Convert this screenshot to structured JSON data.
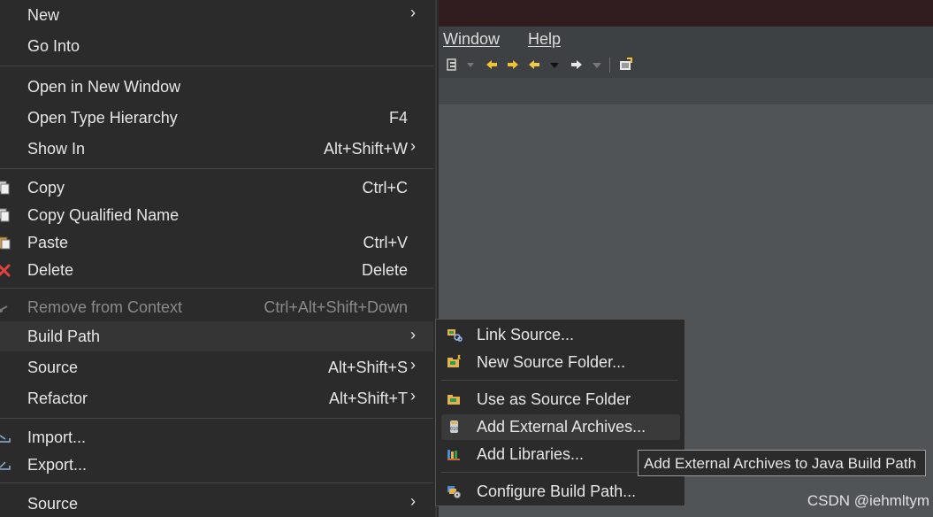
{
  "ide": {
    "menubar": [
      "Window",
      "Help"
    ]
  },
  "menu": {
    "items": [
      {
        "label": "New",
        "accel": "",
        "arrow": "›"
      },
      {
        "label": "Go Into",
        "accel": "",
        "arrow": ""
      },
      {
        "label": "Open in New Window",
        "accel": "",
        "arrow": ""
      },
      {
        "label": "Open Type Hierarchy",
        "accel": "F4",
        "arrow": ""
      },
      {
        "label": "Show In",
        "accel": "Alt+Shift+W",
        "arrow": "›"
      },
      {
        "label": "Copy",
        "accel": "Ctrl+C",
        "arrow": ""
      },
      {
        "label": "Copy Qualified Name",
        "accel": "",
        "arrow": ""
      },
      {
        "label": "Paste",
        "accel": "Ctrl+V",
        "arrow": ""
      },
      {
        "label": "Delete",
        "accel": "Delete",
        "arrow": ""
      },
      {
        "label": "Remove from Context",
        "accel": "Ctrl+Alt+Shift+Down",
        "arrow": ""
      },
      {
        "label": "Build Path",
        "accel": "",
        "arrow": "›"
      },
      {
        "label": "Source",
        "accel": "Alt+Shift+S",
        "arrow": "›"
      },
      {
        "label": "Refactor",
        "accel": "Alt+Shift+T",
        "arrow": "›"
      },
      {
        "label": "Import...",
        "accel": "",
        "arrow": ""
      },
      {
        "label": "Export...",
        "accel": "",
        "arrow": ""
      },
      {
        "label": "Source",
        "accel": "",
        "arrow": "›"
      }
    ]
  },
  "submenu": {
    "items": [
      {
        "label": "Link Source..."
      },
      {
        "label": "New Source Folder..."
      },
      {
        "label": "Use as Source Folder"
      },
      {
        "label": "Add External Archives..."
      },
      {
        "label": "Add Libraries..."
      },
      {
        "label": "Configure Build Path..."
      }
    ]
  },
  "tooltip": "Add External Archives to Java Build Path",
  "watermark": "CSDN @iehmltym",
  "colors": {
    "menu_bg": "#2b2b2b",
    "highlight": "#353535",
    "titlebar": "#311d20",
    "ide_bg": "#505456",
    "delete_icon": "#e0433e"
  }
}
